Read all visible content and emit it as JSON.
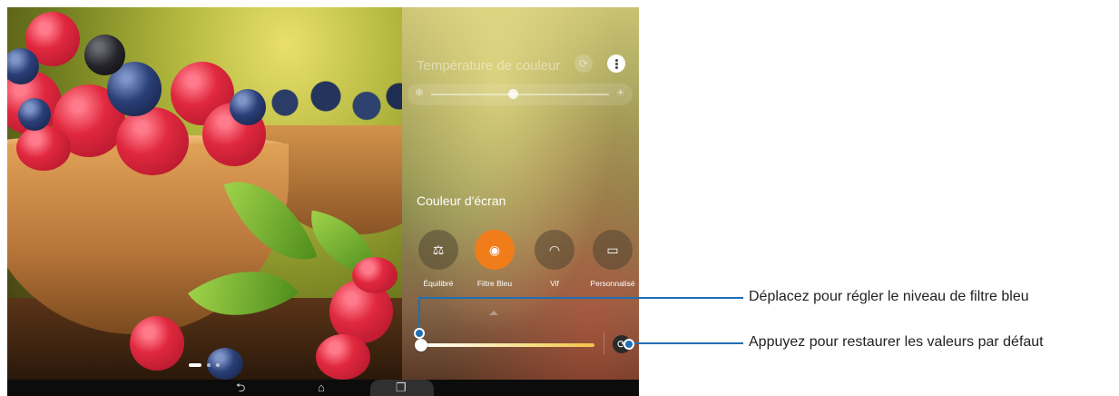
{
  "panel": {
    "title": "Température de couleur",
    "reset_icon": "refresh-icon",
    "more_icon": "more-vertical-icon",
    "temperature_slider": {
      "cold_icon": "❄",
      "warm_icon": "☀",
      "value": 0.46
    },
    "section_label": "Couleur d'écran",
    "modes": [
      {
        "id": "equilibre",
        "label": "Équilibré",
        "icon": "balance-icon",
        "glyph": "⚖",
        "selected": false
      },
      {
        "id": "filtre-bleu",
        "label": "Filtre Bleu",
        "icon": "eye-filter-icon",
        "glyph": "◉",
        "selected": true
      },
      {
        "id": "vif",
        "label": "Vif",
        "icon": "vivid-arcs-icon",
        "glyph": "◠",
        "selected": false
      },
      {
        "id": "personnalise",
        "label": "Personnalisé",
        "icon": "custom-screen-icon",
        "glyph": "▭",
        "selected": false
      }
    ],
    "blue_filter_slider": {
      "value": 0.0
    },
    "restore_icon": "refresh-icon"
  },
  "wallpaper": {
    "page_indicator": {
      "pages": 3,
      "current": 1
    }
  },
  "navbar": {
    "back_icon": "back-icon",
    "home_icon": "home-icon",
    "recent_icon": "recent-apps-icon",
    "back_glyph": "⮌",
    "home_glyph": "⌂",
    "recent_glyph": "❐"
  },
  "callouts": {
    "slider_text": "Déplacez pour régler le niveau de filtre bleu",
    "reset_text": "Appuyez pour restaurer les valeurs par défaut"
  },
  "colors": {
    "accent_orange": "#f07d1a",
    "callout_blue": "#1f6fb4"
  }
}
